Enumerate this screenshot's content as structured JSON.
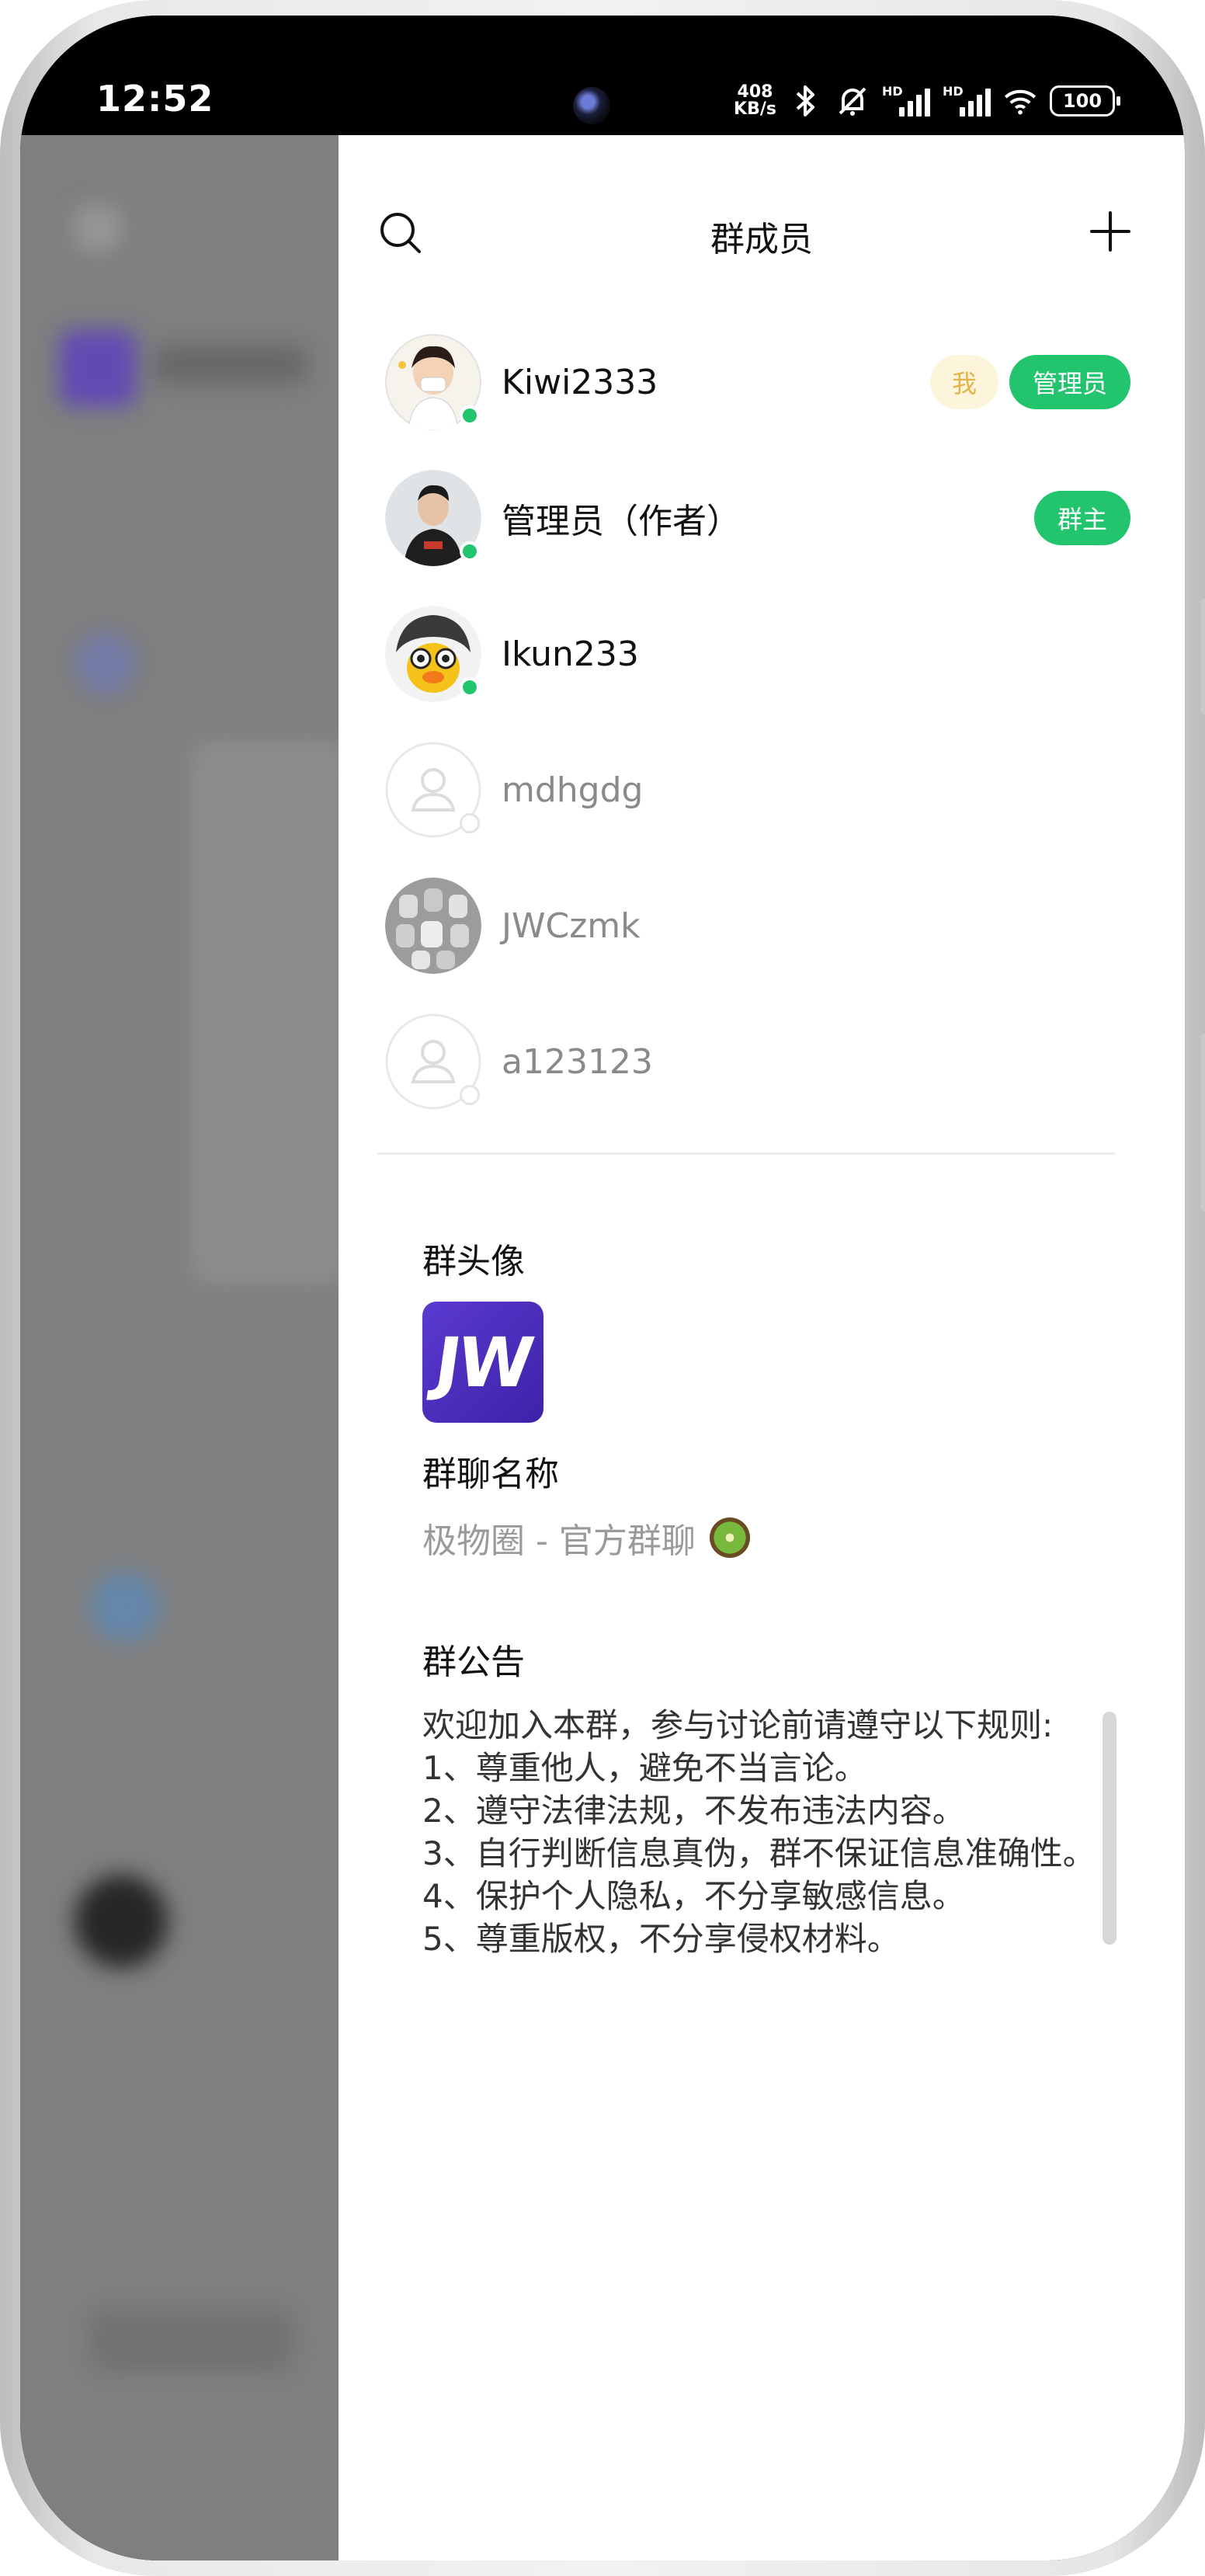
{
  "status_bar": {
    "time": "12:52",
    "net_speed_value": "408",
    "net_speed_unit": "KB/s",
    "signal_1_label": "HD",
    "signal_2_label": "HD",
    "battery": "100"
  },
  "drawer": {
    "title": "群成员",
    "members": [
      {
        "name": "Kiwi2333",
        "online": true,
        "badge_me": "我",
        "role": "管理员"
      },
      {
        "name": "管理员（作者）",
        "online": true,
        "role": "群主"
      },
      {
        "name": "Ikun233",
        "online": true
      },
      {
        "name": "mdhgdg",
        "online": false
      },
      {
        "name": "JWCzmk",
        "online": false
      },
      {
        "name": "a123123",
        "online": false
      }
    ],
    "group_avatar_label": "群头像",
    "group_avatar_text": "JW",
    "group_name_label": "群聊名称",
    "group_name": "极物圈 - 官方群聊",
    "notice_label": "群公告",
    "notice_text": "欢迎加入本群，参与讨论前请遵守以下规则:\n1、尊重他人，避免不当言论。\n2、遵守法律法规，不发布违法内容。\n3、自行判断信息真伪，群不保证信息准确性。\n4、保护个人隐私，不分享敏感信息。\n5、尊重版权，不分享侵权材料。"
  },
  "colors": {
    "accent": "#22c46e",
    "badge_me_bg": "#fdf4dc",
    "badge_me_text": "#e3b54a",
    "group_avatar": "#4a2dbd"
  }
}
